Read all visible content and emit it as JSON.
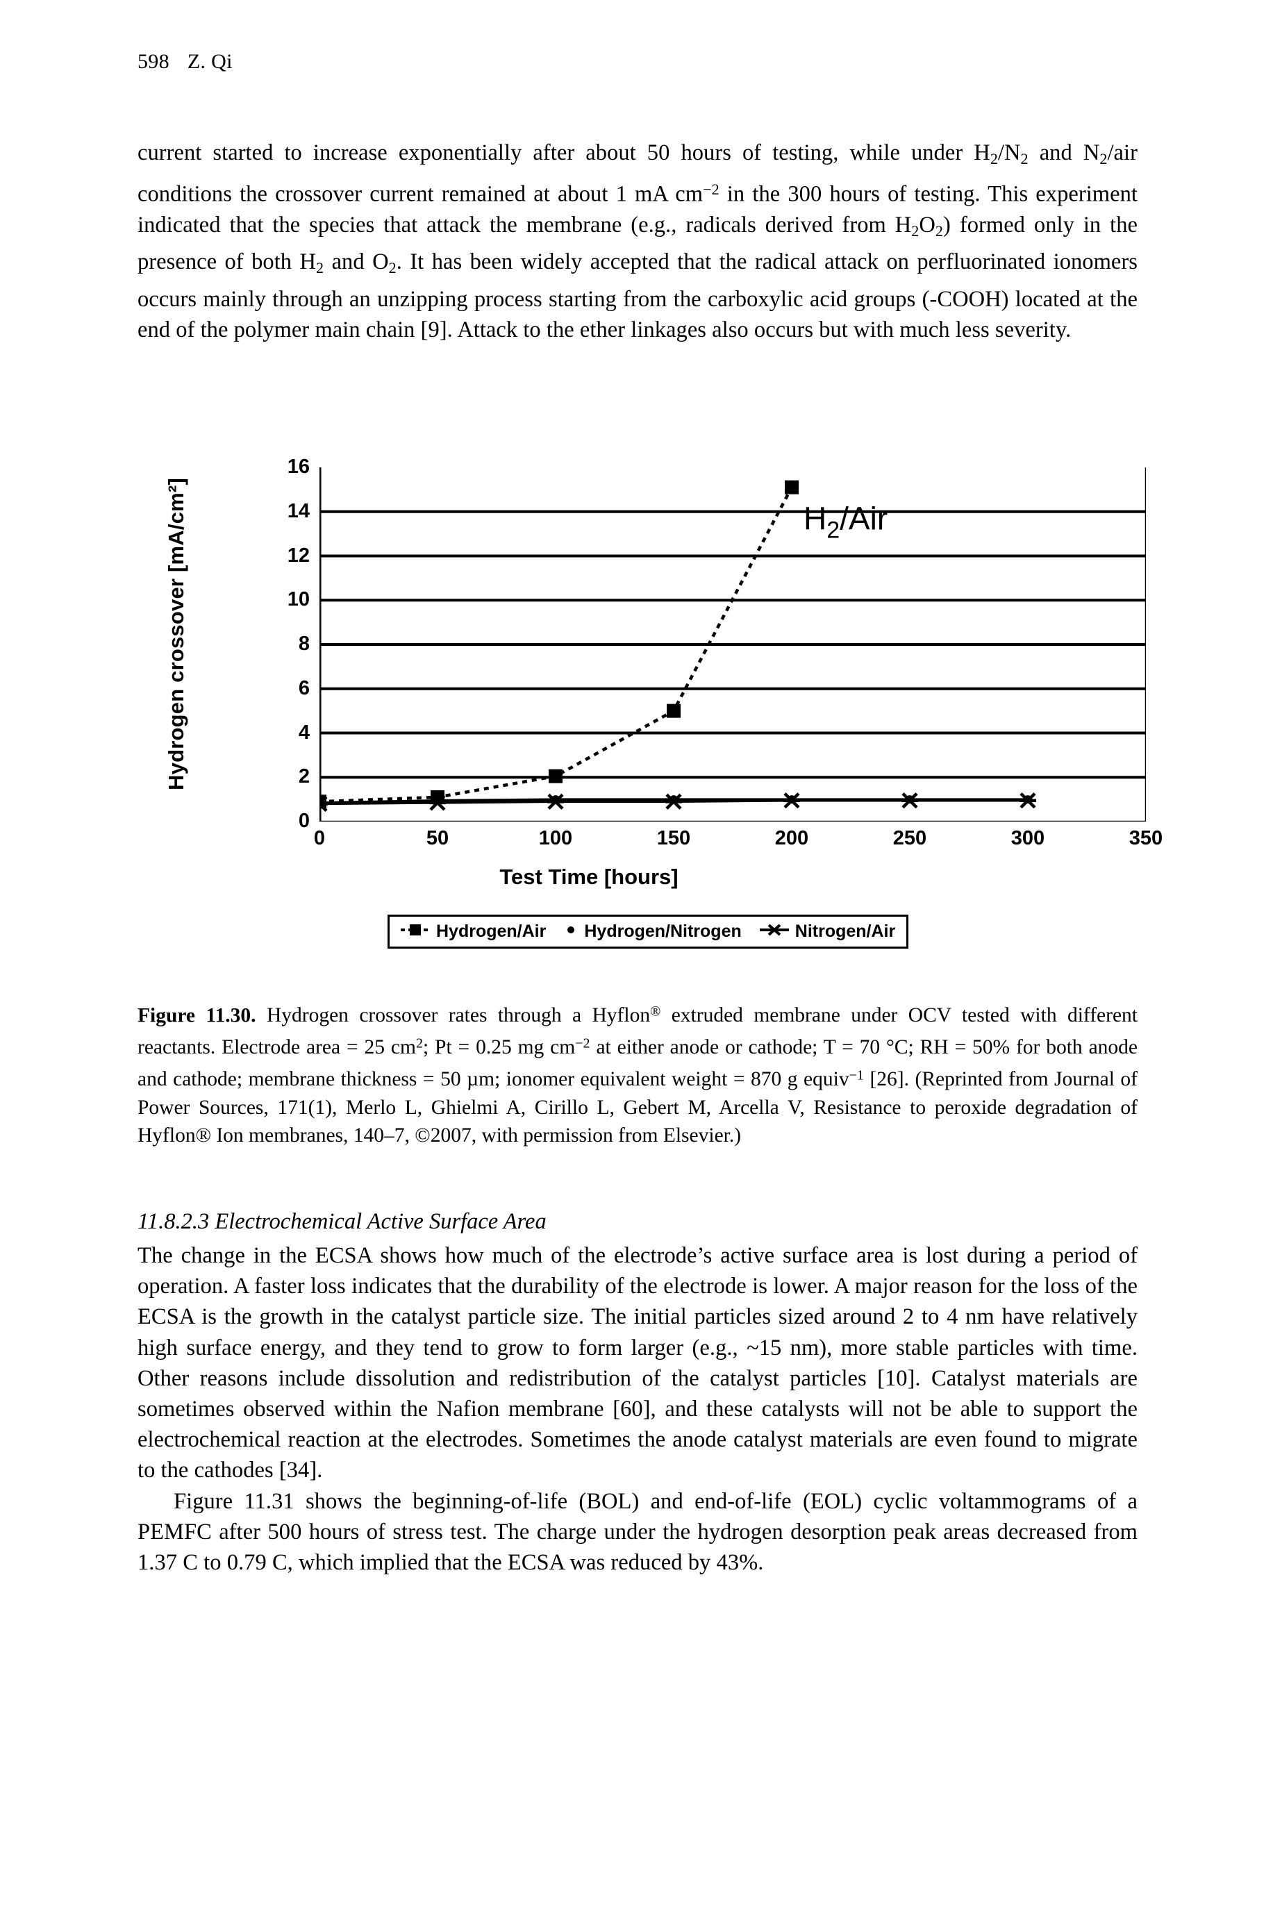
{
  "header": {
    "folio": "598",
    "author": "Z. Qi"
  },
  "body": {
    "paragraph_1_runs": [
      {
        "t": "current started to increase exponentially after about 50 hours of testing, while under H"
      },
      {
        "t": "2",
        "k": "sub"
      },
      {
        "t": "/N"
      },
      {
        "t": "2",
        "k": "sub"
      },
      {
        "t": " and N"
      },
      {
        "t": "2",
        "k": "sub"
      },
      {
        "t": "/air conditions the crossover current remained at about 1 mA cm"
      },
      {
        "t": "−2",
        "k": "sup"
      },
      {
        "t": " in the 300 hours of testing. This experiment indicated that the species that attack the membrane (e.g., radicals derived from H"
      },
      {
        "t": "2",
        "k": "sub"
      },
      {
        "t": "O"
      },
      {
        "t": "2",
        "k": "sub"
      },
      {
        "t": ") formed only in the presence of both H"
      },
      {
        "t": "2",
        "k": "sub"
      },
      {
        "t": " and O"
      },
      {
        "t": "2",
        "k": "sub"
      },
      {
        "t": ". It has been widely accepted that the radical attack on perfluorinated ionomers occurs mainly through an unzipping process starting from the carboxylic acid groups (-COOH) located at the end of the polymer main chain [9]. Attack to the ether linkages also occurs but with much less severity."
      }
    ],
    "section_heading": "11.8.2.3 Electrochemical Active Surface Area",
    "paragraph_2_runs": [
      {
        "t": "The change in the ECSA shows how much of the electrode’s active surface area is lost during a period of operation. A faster loss indicates that the durability of the electrode is lower. A major reason for the loss of the ECSA is the growth in the catalyst particle size. The initial particles sized around 2 to 4 nm have relatively high surface energy, and they tend to grow to form larger (e.g., ~15 nm), more stable particles with time. Other reasons include dissolution and redistribution of the catalyst particles [10]. Catalyst materials are sometimes observed within the Nafion membrane [60], and these catalysts will not be able to support the electrochemical reaction at the electrodes. Sometimes the anode catalyst materials are even found to migrate to the cathodes [34]."
      },
      {
        "t": " ",
        "k": "break"
      },
      {
        "t": "Figure 11.31 shows the beginning-of-life (BOL) and end-of-life (EOL) cyclic voltammograms of a PEMFC after 500 hours of stress test. The charge under the hydrogen desorption peak areas decreased from 1.37 C to 0.79 C, which implied that the ECSA was reduced by 43%.",
        "k": "indent"
      }
    ]
  },
  "caption": {
    "label": "Figure 11.30.",
    "runs": [
      {
        "t": " Hydrogen crossover rates through a Hyflon"
      },
      {
        "t": "®",
        "k": "sup"
      },
      {
        "t": " extruded membrane under OCV tested with different reactants. Electrode area = 25 cm"
      },
      {
        "t": "2",
        "k": "sup"
      },
      {
        "t": "; Pt = 0.25 mg cm"
      },
      {
        "t": "−2",
        "k": "sup"
      },
      {
        "t": " at either anode or cathode; T = 70 °C; RH = 50% for both anode and cathode; membrane thickness = 50 µm; ionomer equivalent weight = 870 g equiv"
      },
      {
        "t": "−1",
        "k": "sup"
      },
      {
        "t": " [26]. (Reprinted from Journal of Power Sources, 171(1), Merlo L, Ghielmi A, Cirillo L, Gebert M, Arcella V, Resistance to peroxide degradation of Hyflon® Ion membranes, 140–7, ©2007, with permission from Elsevier.)"
      }
    ]
  },
  "chart_data": {
    "type": "line",
    "title": "",
    "xlabel": "Test Time [hours]",
    "ylabel": "Hydrogen crossover [mA/cm²]",
    "xlim": [
      0,
      350
    ],
    "ylim": [
      0,
      16
    ],
    "xticks": [
      0,
      50,
      100,
      150,
      200,
      250,
      300,
      350
    ],
    "yticks": [
      0,
      2,
      4,
      6,
      8,
      10,
      12,
      14,
      16
    ],
    "grid": "horizontal",
    "annotations": [
      {
        "text": "H₂/Air",
        "x": 205,
        "y": 13.2
      }
    ],
    "legend_position": "below-plot",
    "series": [
      {
        "name": "Hydrogen/Air",
        "marker": "square",
        "x": [
          0,
          50,
          100,
          150,
          200
        ],
        "values": [
          0.9,
          1.1,
          2.05,
          5.0,
          15.1
        ]
      },
      {
        "name": "Hydrogen/Nitrogen",
        "marker": "dot",
        "x": [
          0,
          50,
          100,
          150,
          200,
          250,
          300
        ],
        "values": [
          0.85,
          0.95,
          1.0,
          1.0,
          1.0,
          1.0,
          1.0
        ]
      },
      {
        "name": "Nitrogen/Air",
        "marker": "cross",
        "x": [
          0,
          50,
          100,
          150,
          200,
          250,
          300
        ],
        "values": [
          0.8,
          0.85,
          0.9,
          0.9,
          0.95,
          0.95,
          0.95
        ]
      }
    ]
  },
  "colors": {
    "ink": "#000000",
    "paper": "#ffffff"
  }
}
